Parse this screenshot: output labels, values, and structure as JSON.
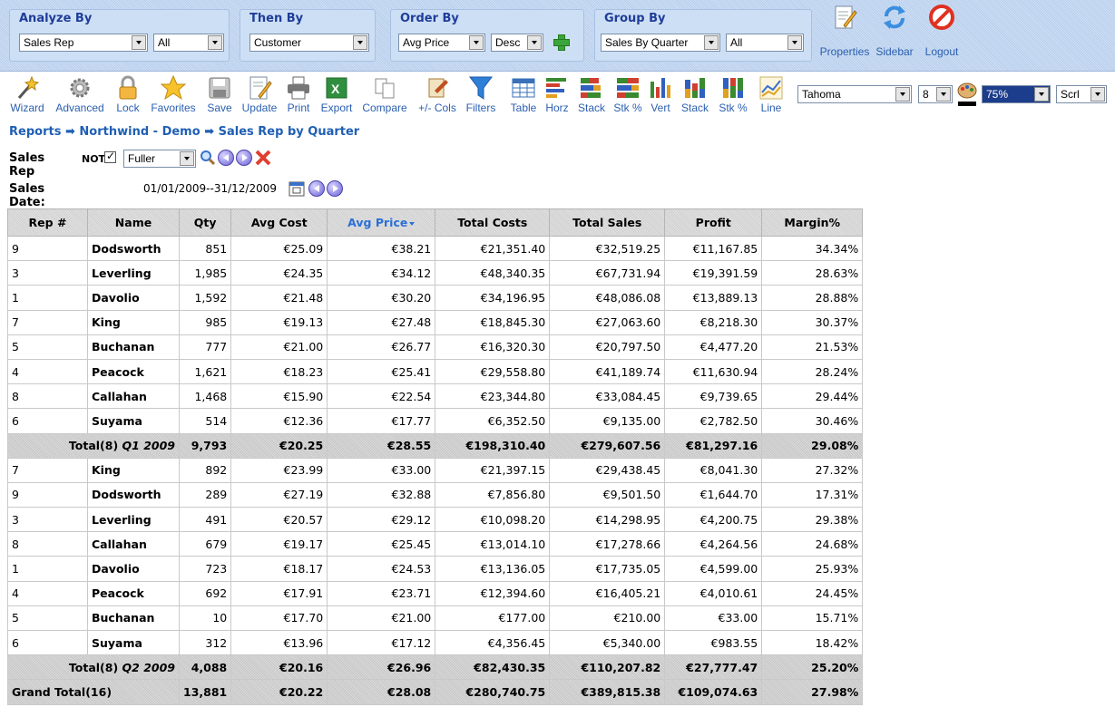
{
  "criteria": {
    "analyze_by": {
      "title": "Analyze By",
      "field": "Sales Rep",
      "filter": "All"
    },
    "then_by": {
      "title": "Then By",
      "field": "Customer"
    },
    "order_by": {
      "title": "Order By",
      "field": "Avg Price",
      "direction": "Desc"
    },
    "group_by": {
      "title": "Group By",
      "field": "Sales By Quarter",
      "filter": "All"
    }
  },
  "top_actions": {
    "properties": "Properties",
    "sidebar": "Sidebar",
    "logout": "Logout"
  },
  "toolbar": {
    "items": [
      {
        "label": "Wizard",
        "icon": "wizard-icon"
      },
      {
        "label": "Advanced",
        "icon": "gear-icon"
      },
      {
        "label": "Lock",
        "icon": "lock-icon"
      },
      {
        "label": "Favorites",
        "icon": "star-icon"
      },
      {
        "label": "Save",
        "icon": "floppy-icon"
      },
      {
        "label": "Update",
        "icon": "update-icon"
      },
      {
        "label": "Print",
        "icon": "printer-icon"
      },
      {
        "label": "Export",
        "icon": "excel-icon"
      },
      {
        "label": "Compare",
        "icon": "compare-icon"
      },
      {
        "label": "+/- Cols",
        "icon": "columns-icon"
      },
      {
        "label": "Filters",
        "icon": "funnel-icon"
      },
      {
        "label": "Table",
        "icon": "table-icon"
      },
      {
        "label": "Horz",
        "icon": "horizontal-bar-icon"
      },
      {
        "label": "Stack",
        "icon": "stacked-horizontal-icon"
      },
      {
        "label": "Stk %",
        "icon": "stacked-percent-horizontal-icon"
      },
      {
        "label": "Vert",
        "icon": "vertical-bar-icon"
      },
      {
        "label": "Stack",
        "icon": "stacked-vertical-icon"
      },
      {
        "label": "Stk %",
        "icon": "stacked-percent-vertical-icon"
      },
      {
        "label": "Line",
        "icon": "line-chart-icon"
      }
    ],
    "font": "Tahoma",
    "font_size": "8",
    "zoom": "75%",
    "scroll": "Scrl"
  },
  "breadcrumb": {
    "root": "Reports",
    "project": "Northwind - Demo",
    "report": "Sales Rep by Quarter",
    "separator": "➡"
  },
  "filters": {
    "sales_rep_label": "Sales Rep",
    "not_label": "NOT",
    "sales_rep_value": "Fuller",
    "sales_date_label": "Sales Date:",
    "sales_date_value": "01/01/2009--31/12/2009"
  },
  "table": {
    "columns": [
      "Rep #",
      "Name",
      "Qty",
      "Avg Cost",
      "Avg Price",
      "Total Costs",
      "Total Sales",
      "Profit",
      "Margin%"
    ],
    "groups": [
      {
        "rows": [
          [
            "9",
            "Dodsworth",
            "851",
            "€25.09",
            "€38.21",
            "€21,351.40",
            "€32,519.25",
            "€11,167.85",
            "34.34%"
          ],
          [
            "3",
            "Leverling",
            "1,985",
            "€24.35",
            "€34.12",
            "€48,340.35",
            "€67,731.94",
            "€19,391.59",
            "28.63%"
          ],
          [
            "1",
            "Davolio",
            "1,592",
            "€21.48",
            "€30.20",
            "€34,196.95",
            "€48,086.08",
            "€13,889.13",
            "28.88%"
          ],
          [
            "7",
            "King",
            "985",
            "€19.13",
            "€27.48",
            "€18,845.30",
            "€27,063.60",
            "€8,218.30",
            "30.37%"
          ],
          [
            "5",
            "Buchanan",
            "777",
            "€21.00",
            "€26.77",
            "€16,320.30",
            "€20,797.50",
            "€4,477.20",
            "21.53%"
          ],
          [
            "4",
            "Peacock",
            "1,621",
            "€18.23",
            "€25.41",
            "€29,558.80",
            "€41,189.74",
            "€11,630.94",
            "28.24%"
          ],
          [
            "8",
            "Callahan",
            "1,468",
            "€15.90",
            "€22.54",
            "€23,344.80",
            "€33,084.45",
            "€9,739.65",
            "29.44%"
          ],
          [
            "6",
            "Suyama",
            "514",
            "€12.36",
            "€17.77",
            "€6,352.50",
            "€9,135.00",
            "€2,782.50",
            "30.46%"
          ]
        ],
        "total": {
          "label": "Total(8)",
          "period": "Q1 2009",
          "values": [
            "9,793",
            "€20.25",
            "€28.55",
            "€198,310.40",
            "€279,607.56",
            "€81,297.16",
            "29.08%"
          ]
        }
      },
      {
        "rows": [
          [
            "7",
            "King",
            "892",
            "€23.99",
            "€33.00",
            "€21,397.15",
            "€29,438.45",
            "€8,041.30",
            "27.32%"
          ],
          [
            "9",
            "Dodsworth",
            "289",
            "€27.19",
            "€32.88",
            "€7,856.80",
            "€9,501.50",
            "€1,644.70",
            "17.31%"
          ],
          [
            "3",
            "Leverling",
            "491",
            "€20.57",
            "€29.12",
            "€10,098.20",
            "€14,298.95",
            "€4,200.75",
            "29.38%"
          ],
          [
            "8",
            "Callahan",
            "679",
            "€19.17",
            "€25.45",
            "€13,014.10",
            "€17,278.66",
            "€4,264.56",
            "24.68%"
          ],
          [
            "1",
            "Davolio",
            "723",
            "€18.17",
            "€24.53",
            "€13,136.05",
            "€17,735.05",
            "€4,599.00",
            "25.93%"
          ],
          [
            "4",
            "Peacock",
            "692",
            "€17.91",
            "€23.71",
            "€12,394.60",
            "€16,405.21",
            "€4,010.61",
            "24.45%"
          ],
          [
            "5",
            "Buchanan",
            "10",
            "€17.70",
            "€21.00",
            "€177.00",
            "€210.00",
            "€33.00",
            "15.71%"
          ],
          [
            "6",
            "Suyama",
            "312",
            "€13.96",
            "€17.12",
            "€4,356.45",
            "€5,340.00",
            "€983.55",
            "18.42%"
          ]
        ],
        "total": {
          "label": "Total(8)",
          "period": "Q2 2009",
          "values": [
            "4,088",
            "€20.16",
            "€26.96",
            "€82,430.35",
            "€110,207.82",
            "€27,777.47",
            "25.20%"
          ]
        }
      }
    ],
    "grand_total": {
      "label": "Grand Total(16)",
      "values": [
        "13,881",
        "€20.22",
        "€28.08",
        "€280,740.75",
        "€389,815.38",
        "€109,074.63",
        "27.98%"
      ]
    }
  }
}
